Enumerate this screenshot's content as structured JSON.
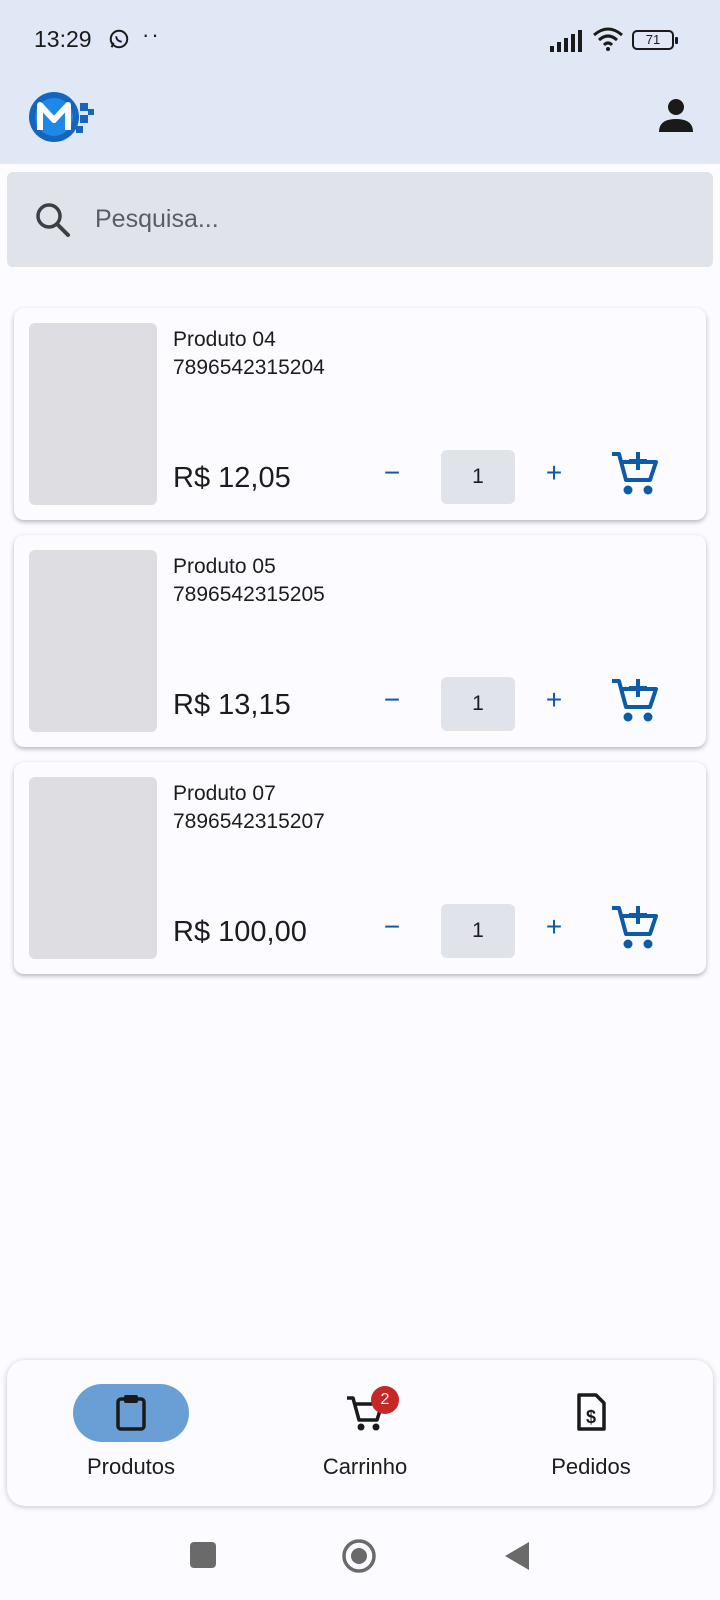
{
  "status_bar": {
    "time": "13:29",
    "dots": "··",
    "battery": "71"
  },
  "app_bar": {
    "logo_icon": "m-logo-icon",
    "profile_icon": "person-icon"
  },
  "search": {
    "placeholder": "Pesquisa...",
    "value": "",
    "icon": "search-icon"
  },
  "products": [
    {
      "name": "Produto 04",
      "code": "7896542315204",
      "price": "R$ 12,05",
      "quantity": "1",
      "minus": "−",
      "plus": "+"
    },
    {
      "name": "Produto 05",
      "code": "7896542315205",
      "price": "R$ 13,15",
      "quantity": "1",
      "minus": "−",
      "plus": "+"
    },
    {
      "name": "Produto 07",
      "code": "7896542315207",
      "price": "R$ 100,00",
      "quantity": "1",
      "minus": "−",
      "plus": "+"
    }
  ],
  "bottom_nav": {
    "items": [
      {
        "label": "Produtos",
        "icon": "clipboard-icon",
        "active": true
      },
      {
        "label": "Carrinho",
        "icon": "cart-icon",
        "badge": "2"
      },
      {
        "label": "Pedidos",
        "icon": "receipt-dollar-icon"
      }
    ]
  },
  "colors": {
    "header_bg": "#e0e8f6",
    "accent_blue": "#0d5aa7",
    "active_pill": "#6a9fd6",
    "badge_red": "#c62828"
  }
}
